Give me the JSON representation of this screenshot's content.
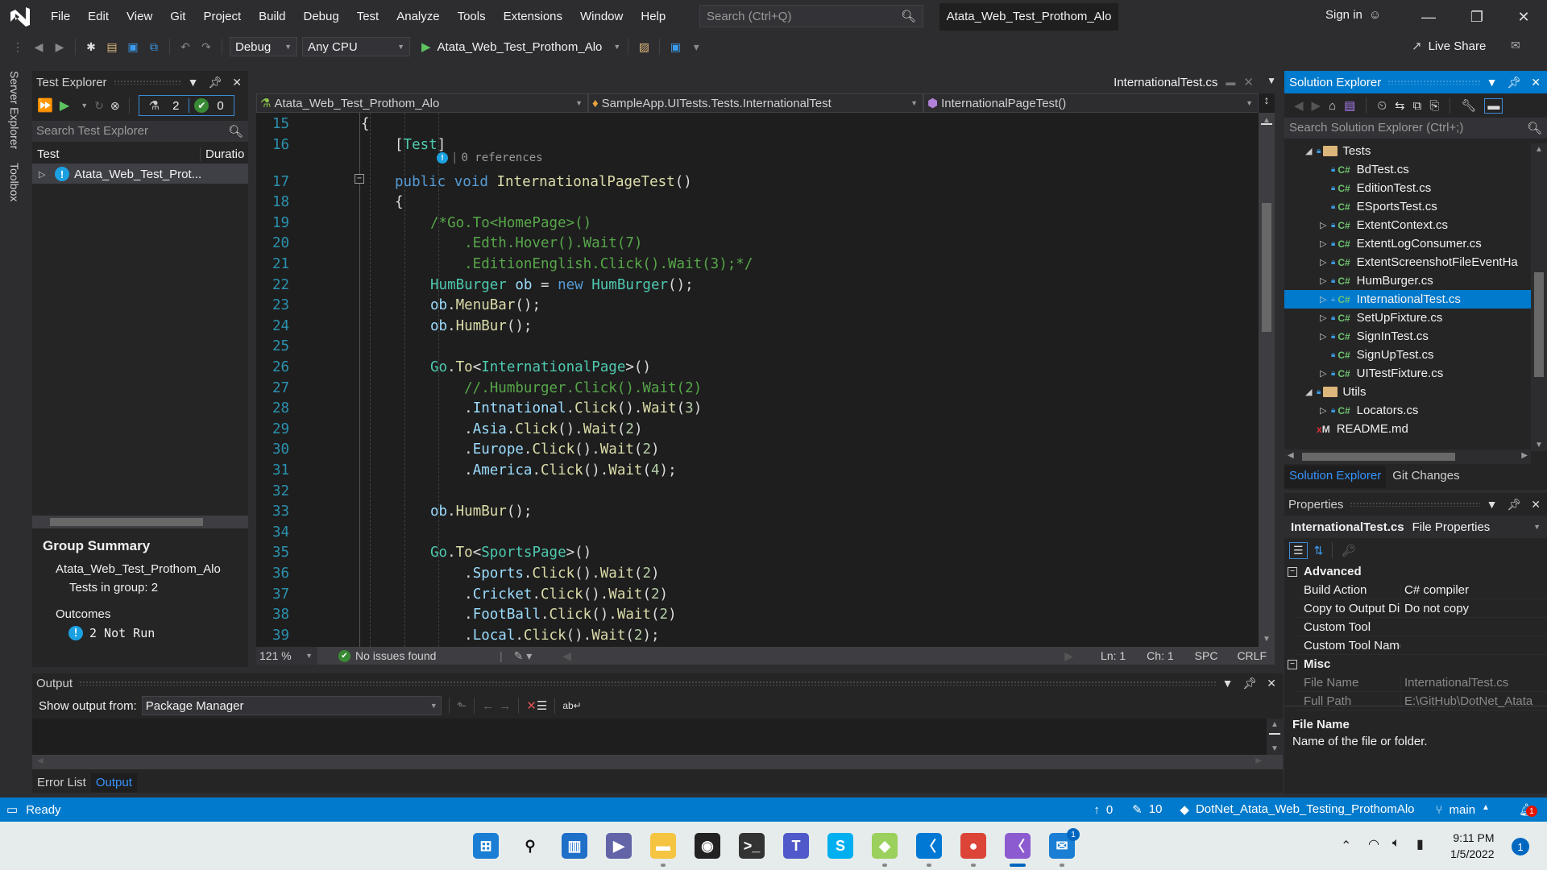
{
  "titlebar": {
    "menu": [
      "File",
      "Edit",
      "View",
      "Git",
      "Project",
      "Build",
      "Debug",
      "Test",
      "Analyze",
      "Tools",
      "Extensions",
      "Window",
      "Help"
    ],
    "search_placeholder": "Search (Ctrl+Q)",
    "solution_name": "Atata_Web_Test_Prothom_Alo",
    "sign_in": "Sign in"
  },
  "toolbar": {
    "configuration": "Debug",
    "platform": "Any CPU",
    "start_target": "Atata_Web_Test_Prothom_Alo",
    "live_share": "Live Share"
  },
  "left_vtabs": [
    "Server Explorer",
    "Toolbox"
  ],
  "test_explorer": {
    "title": "Test Explorer",
    "total_tests": "2",
    "passed_tests": "0",
    "search_placeholder": "Search Test Explorer",
    "columns": [
      "Test",
      "Duratio"
    ],
    "rows": [
      {
        "name": "Atata_Web_Test_Prot...",
        "status": "not-run"
      }
    ],
    "group_summary": {
      "title": "Group Summary",
      "group_name": "Atata_Web_Test_Prothom_Alo",
      "tests_in_group_label": "Tests in group:",
      "tests_in_group": "2",
      "outcomes_label": "Outcomes",
      "outcome": "2 Not Run"
    }
  },
  "editor": {
    "tab": "InternationalTest.cs",
    "nav_project": "Atata_Web_Test_Prothom_Alo",
    "nav_class": "SampleApp.UITests.Tests.InternationalTest",
    "nav_member": "InternationalPageTest()",
    "codelens": "0 references",
    "lines": [
      {
        "n": "15",
        "tokens": [
          [
            "p",
            "{"
          ]
        ],
        "indent": 0
      },
      {
        "n": "16",
        "tokens": [
          [
            "p",
            "["
          ],
          [
            "type",
            "Test"
          ],
          [
            "p",
            "]"
          ]
        ],
        "indent": 1
      },
      {
        "n": "17",
        "tokens": [
          [
            "kw",
            "public"
          ],
          [
            "p",
            " "
          ],
          [
            "kw",
            "void"
          ],
          [
            "p",
            " "
          ],
          [
            "fn",
            "InternationalPageTest"
          ],
          [
            "p",
            "()"
          ]
        ],
        "indent": 1
      },
      {
        "n": "18",
        "tokens": [
          [
            "p",
            "{"
          ]
        ],
        "indent": 1
      },
      {
        "n": "19",
        "tokens": [
          [
            "cm",
            "/*Go.To<HomePage>()"
          ]
        ],
        "indent": 2
      },
      {
        "n": "20",
        "tokens": [
          [
            "cm",
            "    .Edth.Hover().Wait(7)"
          ]
        ],
        "indent": 2
      },
      {
        "n": "21",
        "tokens": [
          [
            "cm",
            "    .EditionEnglish.Click().Wait(3);*/"
          ]
        ],
        "indent": 2
      },
      {
        "n": "22",
        "tokens": [
          [
            "type",
            "HumBurger"
          ],
          [
            "p",
            " "
          ],
          [
            "id",
            "ob"
          ],
          [
            "p",
            " = "
          ],
          [
            "kw",
            "new"
          ],
          [
            "p",
            " "
          ],
          [
            "type",
            "HumBurger"
          ],
          [
            "p",
            "();"
          ]
        ],
        "indent": 2
      },
      {
        "n": "23",
        "tokens": [
          [
            "id",
            "ob"
          ],
          [
            "p",
            "."
          ],
          [
            "fn",
            "MenuBar"
          ],
          [
            "p",
            "();"
          ]
        ],
        "indent": 2
      },
      {
        "n": "24",
        "tokens": [
          [
            "id",
            "ob"
          ],
          [
            "p",
            "."
          ],
          [
            "fn",
            "HumBur"
          ],
          [
            "p",
            "();"
          ]
        ],
        "indent": 2
      },
      {
        "n": "25",
        "tokens": [],
        "indent": 2
      },
      {
        "n": "26",
        "tokens": [
          [
            "type",
            "Go"
          ],
          [
            "p",
            "."
          ],
          [
            "fn",
            "To"
          ],
          [
            "p",
            "<"
          ],
          [
            "type",
            "InternationalPage"
          ],
          [
            "p",
            ">()"
          ]
        ],
        "indent": 2
      },
      {
        "n": "27",
        "tokens": [
          [
            "cm",
            "    //.Humburger.Click().Wait(2)"
          ]
        ],
        "indent": 2
      },
      {
        "n": "28",
        "tokens": [
          [
            "p",
            "    ."
          ],
          [
            "id",
            "Intnational"
          ],
          [
            "p",
            "."
          ],
          [
            "fn",
            "Click"
          ],
          [
            "p",
            "()."
          ],
          [
            "fn",
            "Wait"
          ],
          [
            "p",
            "("
          ],
          [
            "num",
            "3"
          ],
          [
            "p",
            ")"
          ]
        ],
        "indent": 2
      },
      {
        "n": "29",
        "tokens": [
          [
            "p",
            "    ."
          ],
          [
            "id",
            "Asia"
          ],
          [
            "p",
            "."
          ],
          [
            "fn",
            "Click"
          ],
          [
            "p",
            "()."
          ],
          [
            "fn",
            "Wait"
          ],
          [
            "p",
            "("
          ],
          [
            "num",
            "2"
          ],
          [
            "p",
            ")"
          ]
        ],
        "indent": 2
      },
      {
        "n": "30",
        "tokens": [
          [
            "p",
            "    ."
          ],
          [
            "id",
            "Europe"
          ],
          [
            "p",
            "."
          ],
          [
            "fn",
            "Click"
          ],
          [
            "p",
            "()."
          ],
          [
            "fn",
            "Wait"
          ],
          [
            "p",
            "("
          ],
          [
            "num",
            "2"
          ],
          [
            "p",
            ")"
          ]
        ],
        "indent": 2
      },
      {
        "n": "31",
        "tokens": [
          [
            "p",
            "    ."
          ],
          [
            "id",
            "America"
          ],
          [
            "p",
            "."
          ],
          [
            "fn",
            "Click"
          ],
          [
            "p",
            "()."
          ],
          [
            "fn",
            "Wait"
          ],
          [
            "p",
            "("
          ],
          [
            "num",
            "4"
          ],
          [
            "p",
            ");"
          ]
        ],
        "indent": 2
      },
      {
        "n": "32",
        "tokens": [],
        "indent": 2
      },
      {
        "n": "33",
        "tokens": [
          [
            "id",
            "ob"
          ],
          [
            "p",
            "."
          ],
          [
            "fn",
            "HumBur"
          ],
          [
            "p",
            "();"
          ]
        ],
        "indent": 2
      },
      {
        "n": "34",
        "tokens": [],
        "indent": 2
      },
      {
        "n": "35",
        "tokens": [
          [
            "type",
            "Go"
          ],
          [
            "p",
            "."
          ],
          [
            "fn",
            "To"
          ],
          [
            "p",
            "<"
          ],
          [
            "type",
            "SportsPage"
          ],
          [
            "p",
            ">()"
          ]
        ],
        "indent": 2
      },
      {
        "n": "36",
        "tokens": [
          [
            "p",
            "    ."
          ],
          [
            "id",
            "Sports"
          ],
          [
            "p",
            "."
          ],
          [
            "fn",
            "Click"
          ],
          [
            "p",
            "()."
          ],
          [
            "fn",
            "Wait"
          ],
          [
            "p",
            "("
          ],
          [
            "num",
            "2"
          ],
          [
            "p",
            ")"
          ]
        ],
        "indent": 2
      },
      {
        "n": "37",
        "tokens": [
          [
            "p",
            "    ."
          ],
          [
            "id",
            "Cricket"
          ],
          [
            "p",
            "."
          ],
          [
            "fn",
            "Click"
          ],
          [
            "p",
            "()."
          ],
          [
            "fn",
            "Wait"
          ],
          [
            "p",
            "("
          ],
          [
            "num",
            "2"
          ],
          [
            "p",
            ")"
          ]
        ],
        "indent": 2
      },
      {
        "n": "38",
        "tokens": [
          [
            "p",
            "    ."
          ],
          [
            "id",
            "FootBall"
          ],
          [
            "p",
            "."
          ],
          [
            "fn",
            "Click"
          ],
          [
            "p",
            "()."
          ],
          [
            "fn",
            "Wait"
          ],
          [
            "p",
            "("
          ],
          [
            "num",
            "2"
          ],
          [
            "p",
            ")"
          ]
        ],
        "indent": 2
      },
      {
        "n": "39",
        "tokens": [
          [
            "p",
            "    ."
          ],
          [
            "id",
            "Local"
          ],
          [
            "p",
            "."
          ],
          [
            "fn",
            "Click"
          ],
          [
            "p",
            "()."
          ],
          [
            "fn",
            "Wait"
          ],
          [
            "p",
            "("
          ],
          [
            "num",
            "2"
          ],
          [
            "p",
            ");"
          ]
        ],
        "indent": 2
      }
    ],
    "status": {
      "zoom": "121 %",
      "issues": "No issues found",
      "line": "Ln: 1",
      "char": "Ch: 1",
      "whitespace": "SPC",
      "line_ending": "CRLF"
    }
  },
  "solution_explorer": {
    "title": "Solution Explorer",
    "search_placeholder": "Search Solution Explorer (Ctrl+;)",
    "items": [
      {
        "label": "Tests",
        "type": "folder",
        "level": 0,
        "expander": "open"
      },
      {
        "label": "BdTest.cs",
        "type": "cs",
        "level": 1,
        "expander": ""
      },
      {
        "label": "EditionTest.cs",
        "type": "cs",
        "level": 1,
        "expander": ""
      },
      {
        "label": "ESportsTest.cs",
        "type": "cs",
        "level": 1,
        "expander": ""
      },
      {
        "label": "ExtentContext.cs",
        "type": "cs",
        "level": 1,
        "expander": "closed"
      },
      {
        "label": "ExtentLogConsumer.cs",
        "type": "cs",
        "level": 1,
        "expander": "closed"
      },
      {
        "label": "ExtentScreenshotFileEventHa",
        "type": "cs",
        "level": 1,
        "expander": "closed"
      },
      {
        "label": "HumBurger.cs",
        "type": "cs",
        "level": 1,
        "expander": "closed"
      },
      {
        "label": "InternationalTest.cs",
        "type": "cs",
        "level": 1,
        "expander": "closed",
        "selected": true
      },
      {
        "label": "SetUpFixture.cs",
        "type": "cs",
        "level": 1,
        "expander": "closed"
      },
      {
        "label": "SignInTest.cs",
        "type": "cs",
        "level": 1,
        "expander": "closed"
      },
      {
        "label": "SignUpTest.cs",
        "type": "cs",
        "level": 1,
        "expander": ""
      },
      {
        "label": "UITestFixture.cs",
        "type": "cs",
        "level": 1,
        "expander": "closed"
      },
      {
        "label": "Utils",
        "type": "folder",
        "level": 0,
        "expander": "open"
      },
      {
        "label": "Locators.cs",
        "type": "cs",
        "level": 1,
        "expander": "closed"
      },
      {
        "label": "README.md",
        "type": "md",
        "level": 0,
        "expander": ""
      }
    ],
    "tabs": [
      "Solution Explorer",
      "Git Changes"
    ]
  },
  "properties": {
    "title": "Properties",
    "object_name": "InternationalTest.cs",
    "object_type": "File Properties",
    "categories": [
      {
        "name": "Advanced",
        "rows": [
          {
            "name": "Build Action",
            "value": "C# compiler"
          },
          {
            "name": "Copy to Output Dire",
            "value": "Do not copy"
          },
          {
            "name": "Custom Tool",
            "value": ""
          },
          {
            "name": "Custom Tool Names",
            "value": ""
          }
        ]
      },
      {
        "name": "Misc",
        "rows": [
          {
            "name": "File Name",
            "value": "InternationalTest.cs"
          },
          {
            "name": "Full Path",
            "value": "E:\\GitHub\\DotNet_Atata"
          }
        ]
      }
    ],
    "description_title": "File Name",
    "description_text": "Name of the file or folder."
  },
  "output": {
    "title": "Output",
    "show_from_label": "Show output from:",
    "source": "Package Manager",
    "tabs": [
      "Error List",
      "Output"
    ]
  },
  "statusbar": {
    "state": "Ready",
    "unpushed": "0",
    "changes": "10",
    "repo": "DotNet_Atata_Web_Testing_ProthomAlo",
    "branch": "main",
    "notifications": "1"
  },
  "taskbar": {
    "apps": [
      "Start",
      "Search",
      "Widgets",
      "Teams Chat",
      "File Explorer",
      "OBS Studio",
      "Terminal",
      "Microsoft Teams",
      "Skype",
      "Git",
      "VS Code",
      "Chrome",
      "Visual Studio",
      "Mail"
    ],
    "mail_badge": "1",
    "time": "9:11 PM",
    "date": "1/5/2022",
    "notification_count": "1"
  }
}
